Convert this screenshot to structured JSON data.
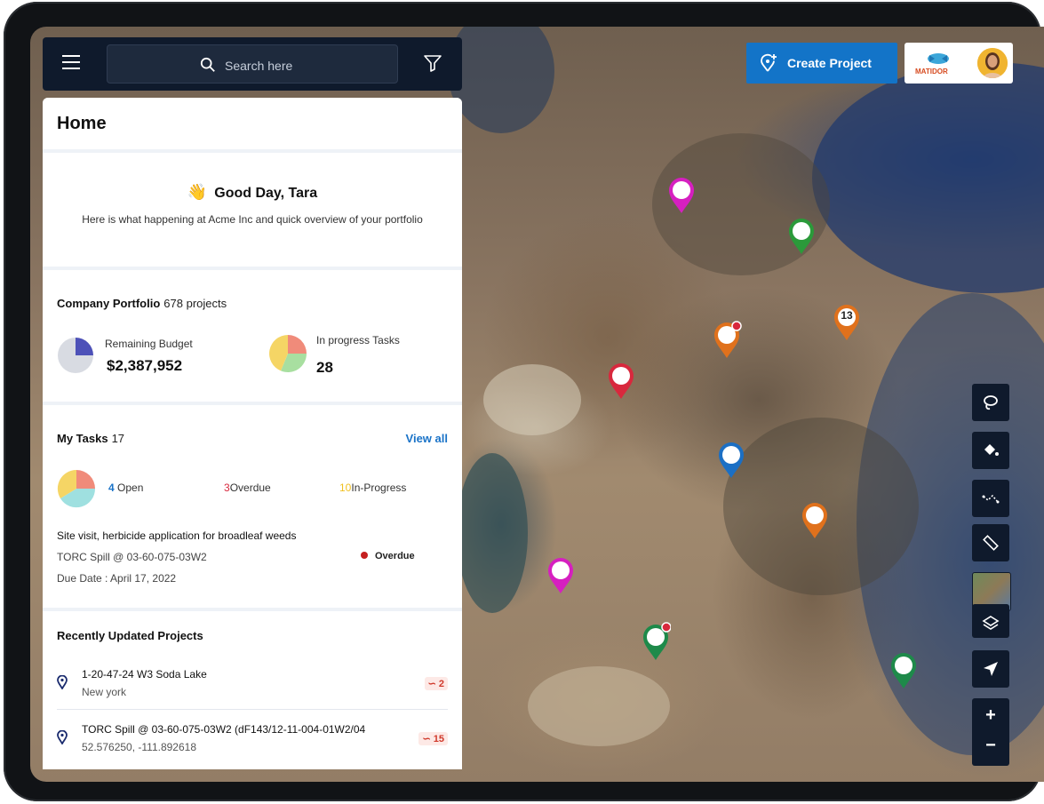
{
  "topbar": {
    "search_placeholder": "Search here"
  },
  "header": {
    "create_project_label": "Create Project",
    "brand_name": "MATIDOR"
  },
  "panel": {
    "title": "Home",
    "greeting": "Good Day, Tara",
    "greeting_sub": "Here is what happening at Acme Inc and quick overview of your portfolio",
    "portfolio": {
      "title": "Company Portfolio",
      "count": "678 projects",
      "budget_label": "Remaining Budget",
      "budget_value": "$2,387,952",
      "tasks_label": "In progress Tasks",
      "tasks_value": "28"
    },
    "my_tasks": {
      "title": "My Tasks",
      "count": "17",
      "view_all": "View all",
      "open_num": "4",
      "open_label": "Open",
      "overdue_num": "3",
      "overdue_label": "Overdue",
      "inprog_num": "10",
      "inprog_label": "In-Progress",
      "task": {
        "title": "Site visit, herbicide application for broadleaf weeds",
        "location": "TORC Spill @ 03-60-075-03W2",
        "due": "Due Date : April 17, 2022",
        "status": "Overdue"
      }
    },
    "recent": {
      "title": "Recently Updated Projects",
      "items": [
        {
          "name": "1-20-47-24 W3 Soda Lake",
          "sub": "New york",
          "badge": "2"
        },
        {
          "name": "TORC Spill @ 03-60-075-03W2 (dF143/12-11-004-01W2/04",
          "sub": "52.576250, -111.892618",
          "badge": "15"
        }
      ]
    }
  },
  "map": {
    "cluster_label": "13",
    "zoom_in": "+",
    "zoom_out": "−"
  },
  "colors": {
    "accent": "#1374c8",
    "dark_nav": "#0f1a2c",
    "overdue": "#c51f1f",
    "magenta": "#d61fc0",
    "green": "#2b9a3a",
    "orange": "#e0711c",
    "red": "#d8283d",
    "blue": "#1b6fc4",
    "teal_green": "#1e8a4a"
  }
}
